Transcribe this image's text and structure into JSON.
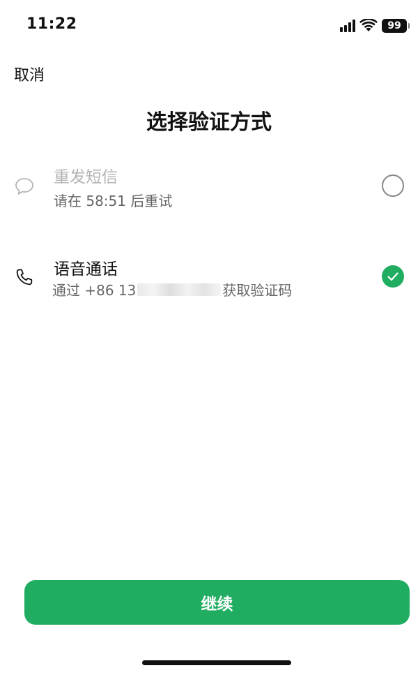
{
  "status_bar": {
    "time": "11:22",
    "battery_level": "99",
    "signal_icon": "cellular-signal-icon",
    "wifi_icon": "wifi-icon"
  },
  "nav": {
    "cancel_label": "取消"
  },
  "title": "选择验证方式",
  "options": [
    {
      "icon": "chat-bubble-icon",
      "title": "重发短信",
      "subtitle": "请在 58:51 后重试",
      "selected": false,
      "disabled": true
    },
    {
      "icon": "phone-icon",
      "title": "语音通话",
      "subtitle_prefix": "通过 +86 13",
      "subtitle_suffix": "获取验证码",
      "selected": true,
      "disabled": false
    }
  ],
  "continue_label": "继续",
  "colors": {
    "accent": "#21ad61",
    "text_primary": "#111111",
    "text_secondary": "#666666",
    "text_disabled": "#b3b3b3"
  }
}
